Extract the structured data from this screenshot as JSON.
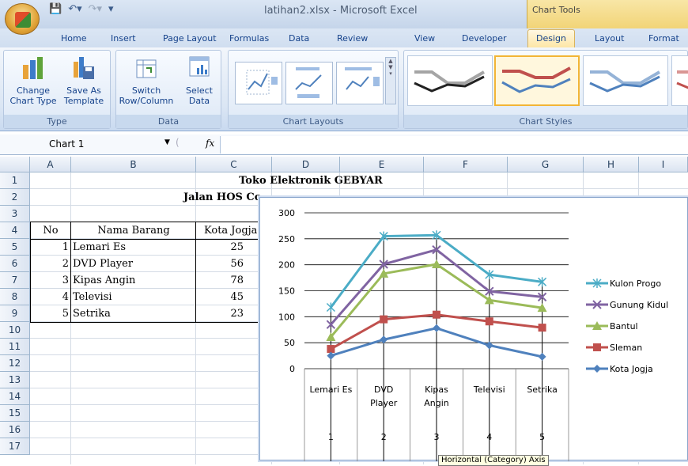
{
  "window": {
    "title": "latihan2.xlsx - Microsoft Excel",
    "context_tab_group": "Chart Tools"
  },
  "tabs": [
    "Home",
    "Insert",
    "Page Layout",
    "Formulas",
    "Data",
    "Review",
    "View",
    "Developer",
    "Design",
    "Layout",
    "Format"
  ],
  "active_tab": "Design",
  "ribbon": {
    "type_group": {
      "label": "Type",
      "change_chart_type": "Change\nChart Type",
      "save_as_template": "Save As\nTemplate"
    },
    "data_group": {
      "label": "Data",
      "switch_row_column": "Switch\nRow/Column",
      "select_data": "Select\nData"
    },
    "layouts_group": {
      "label": "Chart Layouts"
    },
    "styles_group": {
      "label": "Chart Styles"
    }
  },
  "formula_bar": {
    "name_box": "Chart 1",
    "fx": "fx",
    "value": ""
  },
  "columns": [
    "A",
    "B",
    "C",
    "D",
    "E",
    "F",
    "G",
    "H",
    "I"
  ],
  "rows": [
    "1",
    "2",
    "3",
    "4",
    "5",
    "6",
    "7",
    "8",
    "9",
    "10",
    "11",
    "12",
    "13",
    "14",
    "15",
    "16",
    "17"
  ],
  "sheet": {
    "title": "Toko Elektronik GEBYAR",
    "subtitle": "Jalan HOS Co",
    "headers": {
      "no": "No",
      "nama": "Nama Barang",
      "kota": "Kota Jogja"
    },
    "items": [
      {
        "no": "1",
        "nama": "Lemari Es",
        "kota": "25"
      },
      {
        "no": "2",
        "nama": "DVD Player",
        "kota": "56"
      },
      {
        "no": "3",
        "nama": "Kipas Angin",
        "kota": "78"
      },
      {
        "no": "4",
        "nama": "Televisi",
        "kota": "45"
      },
      {
        "no": "5",
        "nama": "Setrika",
        "kota": "23"
      }
    ]
  },
  "chart_data": {
    "type": "line",
    "categories": [
      [
        "Lemari Es"
      ],
      [
        "DVD",
        "Player"
      ],
      [
        "Kipas",
        "Angin"
      ],
      [
        "Televisi"
      ],
      [
        "Setrika"
      ]
    ],
    "category_numbers": [
      "1",
      "2",
      "3",
      "4",
      "5"
    ],
    "ylim": [
      0,
      300
    ],
    "yticks": [
      "0",
      "50",
      "100",
      "150",
      "200",
      "250",
      "300"
    ],
    "grid": true,
    "legend_position": "right",
    "series": [
      {
        "name": "Kulon Progo",
        "color": "#4bacc6",
        "marker": "star",
        "values": [
          118,
          255,
          257,
          181,
          167
        ]
      },
      {
        "name": "Gunung Kidul",
        "color": "#8064a2",
        "marker": "x",
        "values": [
          85,
          201,
          229,
          149,
          138
        ]
      },
      {
        "name": "Bantul",
        "color": "#9bbb59",
        "marker": "triangle",
        "values": [
          61,
          183,
          201,
          132,
          117
        ]
      },
      {
        "name": "Sleman",
        "color": "#c0504d",
        "marker": "square",
        "values": [
          38,
          95,
          104,
          91,
          79
        ]
      },
      {
        "name": "Kota Jogja",
        "color": "#4f81bd",
        "marker": "diamond",
        "values": [
          25,
          56,
          78,
          45,
          23
        ]
      }
    ]
  },
  "tooltip": "Horizontal (Category) Axis"
}
